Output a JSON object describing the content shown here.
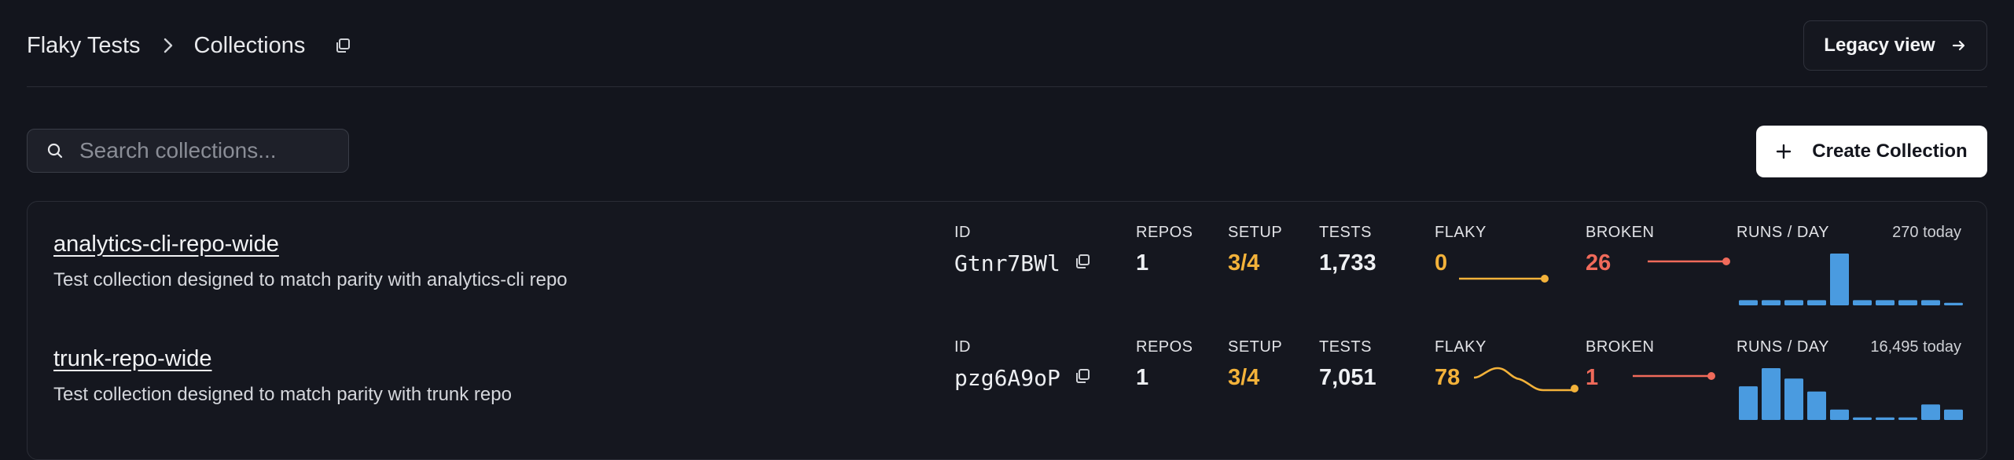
{
  "header": {
    "breadcrumb": [
      "Flaky Tests",
      "Collections"
    ],
    "legacy_label": "Legacy view"
  },
  "toolbar": {
    "search_placeholder": "Search collections...",
    "create_label": "Create Collection"
  },
  "labels": {
    "id": "ID",
    "repos": "REPOS",
    "setup": "SETUP",
    "tests": "TESTS",
    "flaky": "FLAKY",
    "broken": "BROKEN",
    "runs": "RUNS / DAY"
  },
  "colors": {
    "amber": "#f3b23a",
    "red": "#f06a5a",
    "bar": "#4a9be0"
  },
  "collections": [
    {
      "name": "analytics-cli-repo-wide",
      "description": "Test collection designed to match parity with analytics-cli repo",
      "id": "Gtnr7BWl",
      "repos": "1",
      "setup": "3/4",
      "tests": "1,733",
      "flaky": "0",
      "broken": "26",
      "runs_today": "270 today",
      "flaky_trend": [
        0,
        0,
        0,
        0,
        0
      ],
      "broken_trend": [
        26,
        26,
        26,
        26,
        26
      ],
      "runs_per_day": [
        1,
        1,
        1,
        1,
        10,
        1,
        1,
        1,
        1,
        0.5
      ]
    },
    {
      "name": "trunk-repo-wide",
      "description": "Test collection designed to match parity with trunk repo",
      "id": "pzg6A9oP",
      "repos": "1",
      "setup": "3/4",
      "tests": "7,051",
      "flaky": "78",
      "broken": "1",
      "runs_today": "16,495 today",
      "flaky_trend": [
        120,
        140,
        110,
        90,
        70,
        78
      ],
      "broken_trend": [
        1,
        1,
        1,
        1,
        1
      ],
      "runs_per_day": [
        6.5,
        10,
        8,
        5.5,
        2,
        0.5,
        0.5,
        0.5,
        3,
        2
      ]
    }
  ]
}
